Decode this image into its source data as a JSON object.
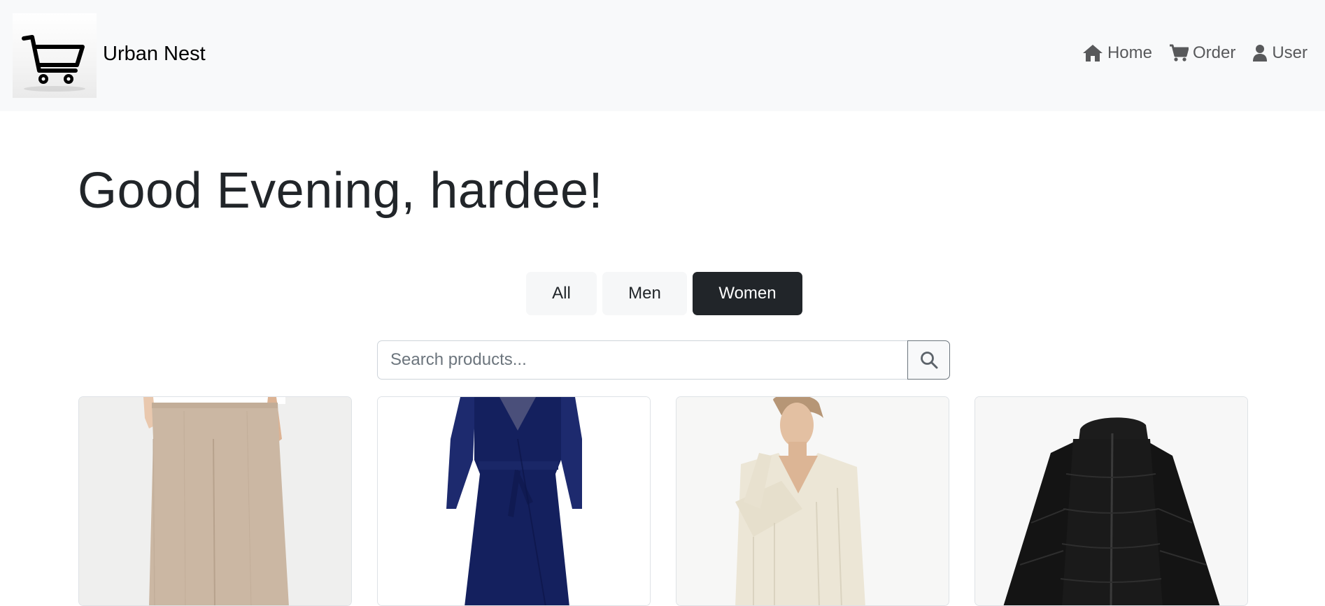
{
  "navbar": {
    "brand_name": "Urban Nest",
    "brand_logo_icon": "shopping-cart-icon",
    "links": [
      {
        "label": "Home",
        "icon": "home-icon"
      },
      {
        "label": "Order",
        "icon": "cart-icon"
      },
      {
        "label": "User",
        "icon": "user-icon"
      }
    ]
  },
  "greeting": "Good Evening, hardee!",
  "filters": {
    "all": "All",
    "men": "Men",
    "women": "Women",
    "active": "Women"
  },
  "search": {
    "placeholder": "Search products...",
    "button_icon": "search-icon"
  },
  "products": [
    {
      "image": "beige-wide-leg-pants"
    },
    {
      "image": "navy-wrap-dress"
    },
    {
      "image": "cream-knit-sweater"
    },
    {
      "image": "black-puffer-jacket"
    }
  ],
  "colors": {
    "navbar_bg": "#f8f9fa",
    "active_filter_bg": "#212529",
    "nav_text": "#58595b"
  }
}
